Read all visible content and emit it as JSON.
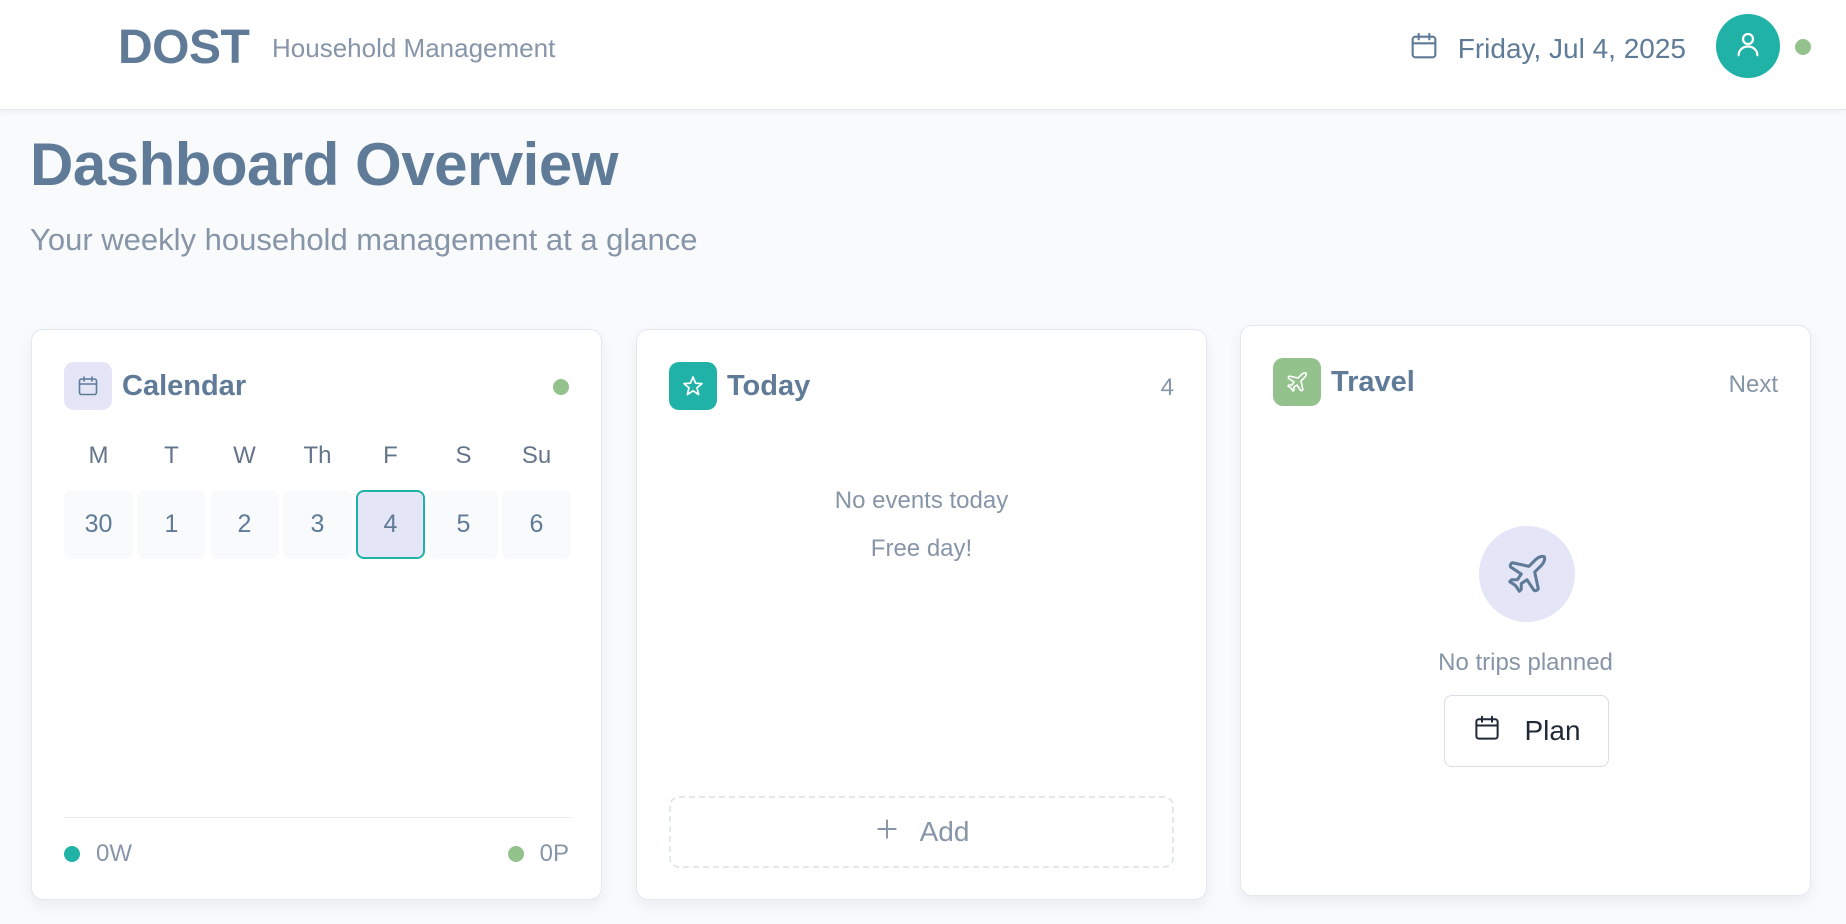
{
  "header": {
    "brand": "DOST",
    "subtitle": "Household Management",
    "date": "Friday, Jul 4, 2025",
    "icons": {
      "date": "calendar-icon",
      "avatar": "user-icon"
    }
  },
  "page": {
    "title": "Dashboard Overview",
    "subtitle": "Your weekly household management at a glance"
  },
  "calendar_card": {
    "title": "Calendar",
    "icon": "calendar-icon",
    "weekdays": [
      "M",
      "T",
      "W",
      "Th",
      "F",
      "S",
      "Su"
    ],
    "days": [
      "30",
      "1",
      "2",
      "3",
      "4",
      "5",
      "6"
    ],
    "selected_day": "4",
    "footer_left": "0W",
    "footer_right": "0P"
  },
  "today_card": {
    "title": "Today",
    "icon": "star-icon",
    "count": "4",
    "empty_title": "No events today",
    "empty_sub": "Free day!",
    "add_label": "Add",
    "add_icon": "plus-icon"
  },
  "travel_card": {
    "title": "Travel",
    "icon": "plane-icon",
    "next_label": "Next",
    "empty_text": "No trips planned",
    "plan_label": "Plan",
    "plan_icon": "calendar-icon"
  },
  "colors": {
    "teal": "#20b2a6",
    "green": "#93c28c",
    "lavender": "#e4e5f7",
    "slate": "#5f7b98",
    "muted": "#8795a8"
  }
}
